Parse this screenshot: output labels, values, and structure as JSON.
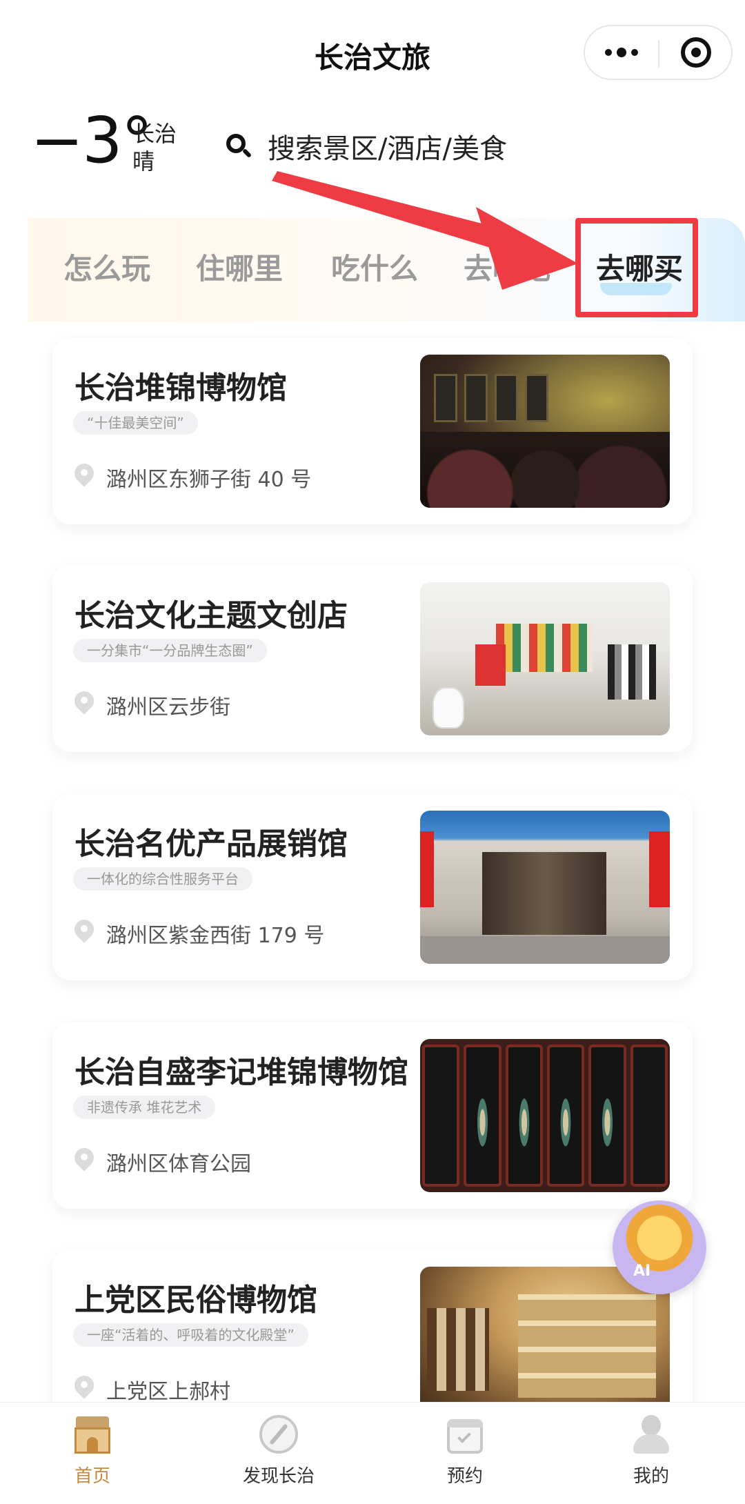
{
  "header": {
    "title": "长治文旅"
  },
  "weather": {
    "temperature": "−3°",
    "city": "长治",
    "condition": "晴"
  },
  "search": {
    "placeholder": "搜索景区/酒店/美食"
  },
  "tabs": [
    {
      "label": "怎么玩"
    },
    {
      "label": "住哪里"
    },
    {
      "label": "吃什么"
    },
    {
      "label": "去哪吃"
    },
    {
      "label": "去哪买",
      "active": true
    }
  ],
  "annotation": {
    "color": "#ee3b44"
  },
  "cards": [
    {
      "title": "长治堆锦博物馆",
      "tag": "“十佳最美空间”",
      "location": "潞州区东狮子街 40 号"
    },
    {
      "title": "长治文化主题文创店",
      "tag": "一分集市“一分品牌生态圈”",
      "location": "潞州区云步街"
    },
    {
      "title": "长治名优产品展销馆",
      "tag": "一体化的综合性服务平台",
      "location": "潞州区紫金西街 179 号"
    },
    {
      "title": "长治自盛李记堆锦博物馆",
      "tag": "非遗传承 堆花艺术",
      "location": "潞州区体育公园"
    },
    {
      "title": "上党区民俗博物馆",
      "tag": "一座“活着的、呼吸着的文化殿堂”",
      "location": "上党区上郝村"
    }
  ],
  "ai_badge": {
    "label": "AI"
  },
  "nav": [
    {
      "label": "首页",
      "icon": "home-icon",
      "active": true
    },
    {
      "label": "发现长治",
      "icon": "compass-icon"
    },
    {
      "label": "预约",
      "icon": "calendar-icon"
    },
    {
      "label": "我的",
      "icon": "user-icon"
    }
  ],
  "colors": {
    "accent": "#c38a3e",
    "highlight": "#ee3b44"
  }
}
